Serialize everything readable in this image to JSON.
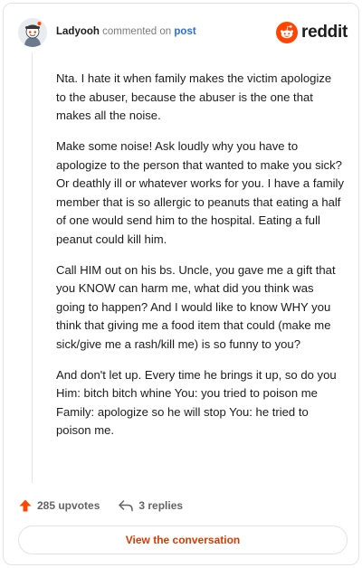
{
  "header": {
    "username": "Ladyooh",
    "action_text": "commented on",
    "post_link": "post",
    "brand_name": "reddit"
  },
  "comment": {
    "paragraphs": [
      "Nta. I hate it when family makes the victim apologize to the abuser, because the abuser is the one that makes all the noise.",
      "Make some noise! Ask loudly why you have to apologize to the person that wanted to make you sick? Or deathly ill or whatever works for you. I have a family member that is so allergic to peanuts that eating a half of one would send him to the hospital. Eating a full peanut could kill him.",
      "Call HIM out on his bs. Uncle, you gave me a gift that you KNOW can harm me, what did you think was going to happen? And I would like to know WHY you think that giving me a food item that could (make me sick/give me a rash/kill me) is so funny to you?",
      "And don't let up. Every time he brings it up, so do you Him: bitch bitch whine You: you tried to poison me Family: apologize so he will stop You: he tried to poison me."
    ]
  },
  "footer": {
    "upvotes": "285 upvotes",
    "replies": "3 replies",
    "view_conversation": "View the conversation"
  },
  "colors": {
    "brand_orange": "#ff4500",
    "link_blue": "#2d6fd2",
    "button_text": "#d93a00",
    "meta_gray": "#646464"
  },
  "icons": {
    "avatar": "snoo-avatar",
    "brand": "reddit-alien-icon",
    "upvote": "upvote-arrow-icon",
    "reply": "reply-arrow-icon"
  }
}
